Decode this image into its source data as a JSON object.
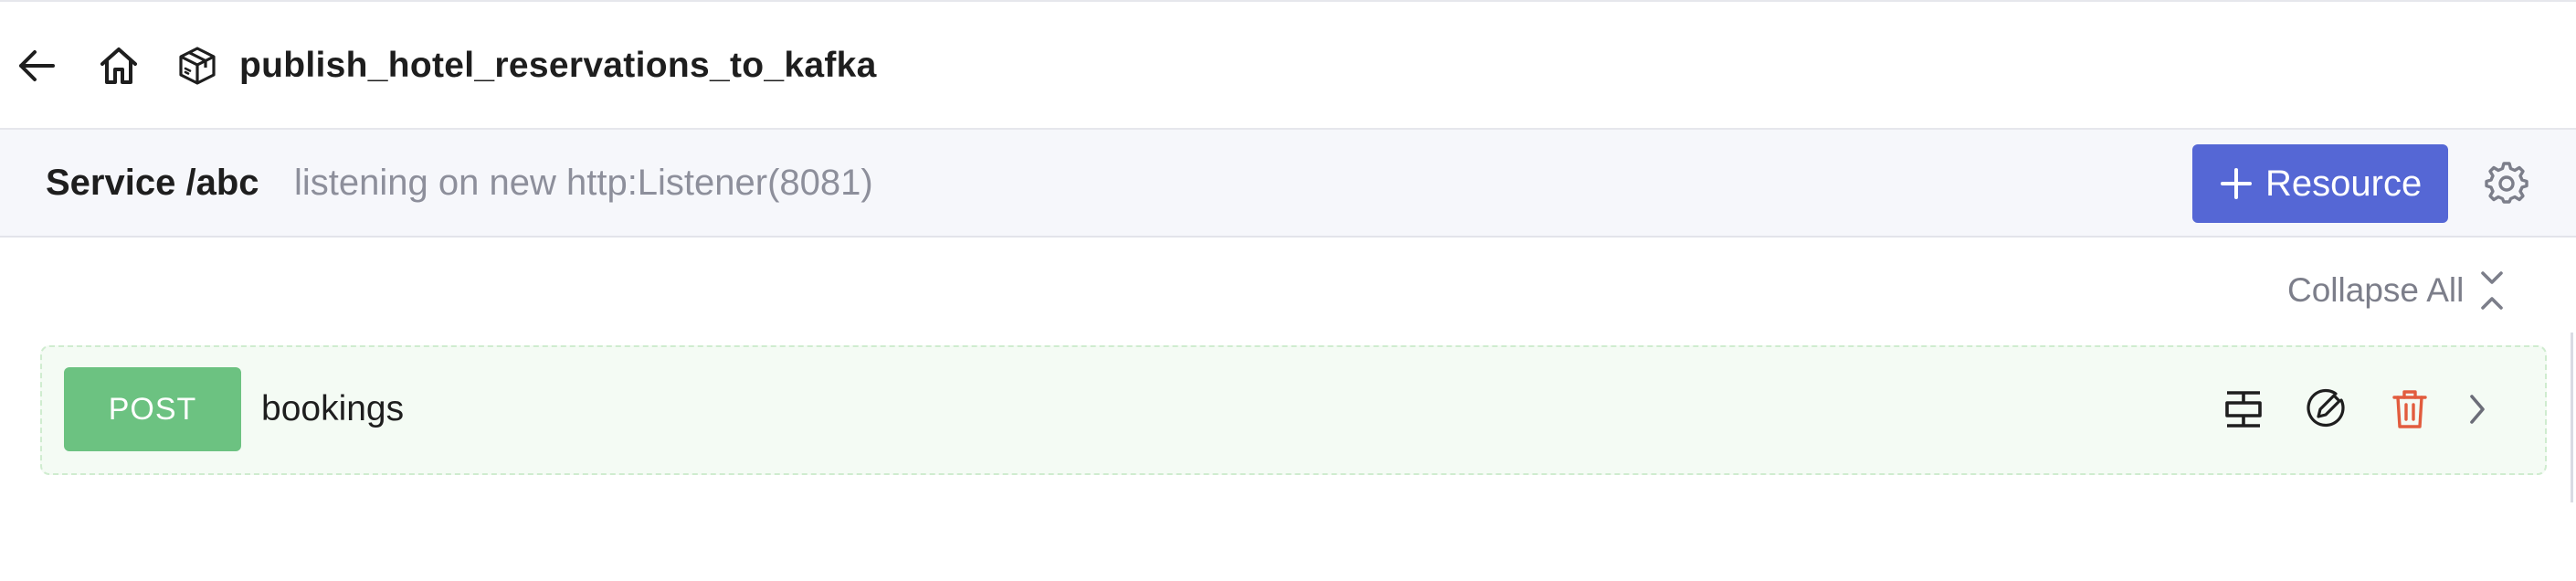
{
  "header": {
    "title": "publish_hotel_reservations_to_kafka",
    "icons": {
      "back": "arrow-left-icon",
      "home": "home-icon",
      "package": "package-icon"
    }
  },
  "service": {
    "name": "Service /abc",
    "listener": "listening on new http:Listener(8081)",
    "add_resource_label": "Resource",
    "settings_icon": "gear-icon"
  },
  "toolbar": {
    "collapse_all_label": "Collapse All",
    "collapse_icon": "collapse-icon"
  },
  "resources": [
    {
      "method": "POST",
      "path": "bookings",
      "actions": [
        "try-it-icon",
        "edit-icon",
        "delete-icon",
        "chevron-right-icon"
      ]
    }
  ],
  "colors": {
    "accent": "#5567d5",
    "post_method": "#6cc281",
    "delete": "#e25c3e",
    "row_background": "#f4fbf4",
    "service_bar": "#f6f7fb"
  }
}
